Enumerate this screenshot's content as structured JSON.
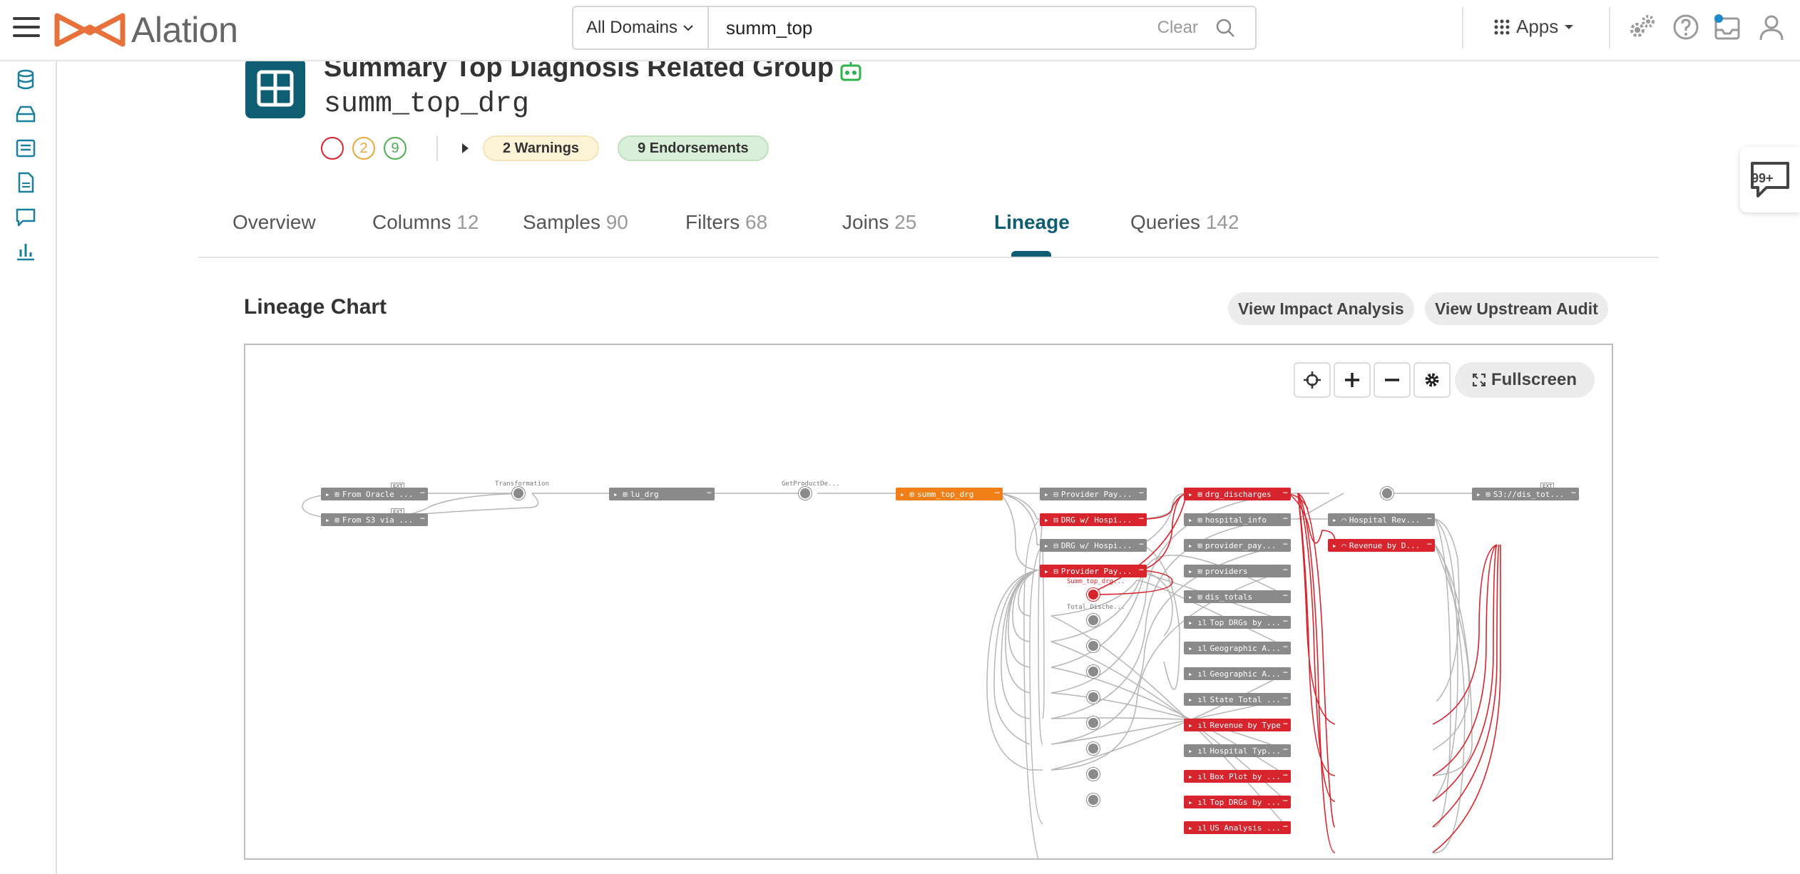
{
  "app": {
    "logo_text": "Alation"
  },
  "search": {
    "domain": "All Domains",
    "query": "summ_top",
    "clear_label": "Clear"
  },
  "topnav": {
    "apps_label": "Apps"
  },
  "object": {
    "title": "Summary Top Diagnosis Related Group",
    "name": "summ_top_drg",
    "trust": {
      "deprecated": "",
      "warnings_count": "2",
      "endorsements_count": "9"
    },
    "warnings_label": "2 Warnings",
    "endorsements_label": "9 Endorsements"
  },
  "tabs": [
    {
      "label": "Overview",
      "count": ""
    },
    {
      "label": "Columns",
      "count": "12"
    },
    {
      "label": "Samples",
      "count": "90"
    },
    {
      "label": "Filters",
      "count": "68"
    },
    {
      "label": "Joins",
      "count": "25"
    },
    {
      "label": "Lineage",
      "count": ""
    },
    {
      "label": "Queries",
      "count": "142"
    }
  ],
  "lineage": {
    "section_title": "Lineage Chart",
    "impact_label": "View Impact Analysis",
    "upstream_label": "View Upstream Audit",
    "fullscreen_label": "Fullscreen",
    "process_labels": {
      "transformation": "Transformation",
      "getproduct": "GetProductDe...",
      "summ_top": "Summ_top_drg...",
      "total_dische": "Total Dische..."
    },
    "ext_tag": "EXT",
    "nodes": {
      "from_oracle": "From Oracle ...",
      "from_s3": "From S3 via ...",
      "lu_drg": "lu_drg",
      "summ_top_drg": "summ_top_drg",
      "provider_pay_1": "Provider Pay...",
      "drg_hospi_1": "DRG w/ Hospi...",
      "drg_hospi_2": "DRG w/ Hospi...",
      "provider_pay_2": "Provider Pay...",
      "drg_discharges": "drg_discharges",
      "hospital_info": "hospital_info",
      "provider_pay_3": "provider_pay...",
      "providers": "providers",
      "dis_totals": "dis_totals",
      "top_drgs_1": "Top DRGs by ...",
      "geo_1": "Geographic A...",
      "geo_2": "Geographic A...",
      "state_total": "State Total ...",
      "revenue_type": "Revenue by Type",
      "hospital_typ": "Hospital Typ...",
      "box_plot": "Box Plot by ...",
      "top_drgs_2": "Top DRGs by ...",
      "us_analysis": "US Analysis ...",
      "hospital_rev": "Hospital Rev...",
      "revenue_d": "Revenue by D...",
      "s3_dis_tot": "S3://dis_tot..."
    }
  },
  "colors": {
    "brand": "#0f5d73",
    "orange": "#f07f18",
    "red": "#d8242d",
    "gray_node": "#8a8a8a",
    "logo": "#e8703a",
    "endorse": "#4caf50",
    "warn": "#e8a93a"
  },
  "widgets": {
    "chat_badge": "99+"
  }
}
